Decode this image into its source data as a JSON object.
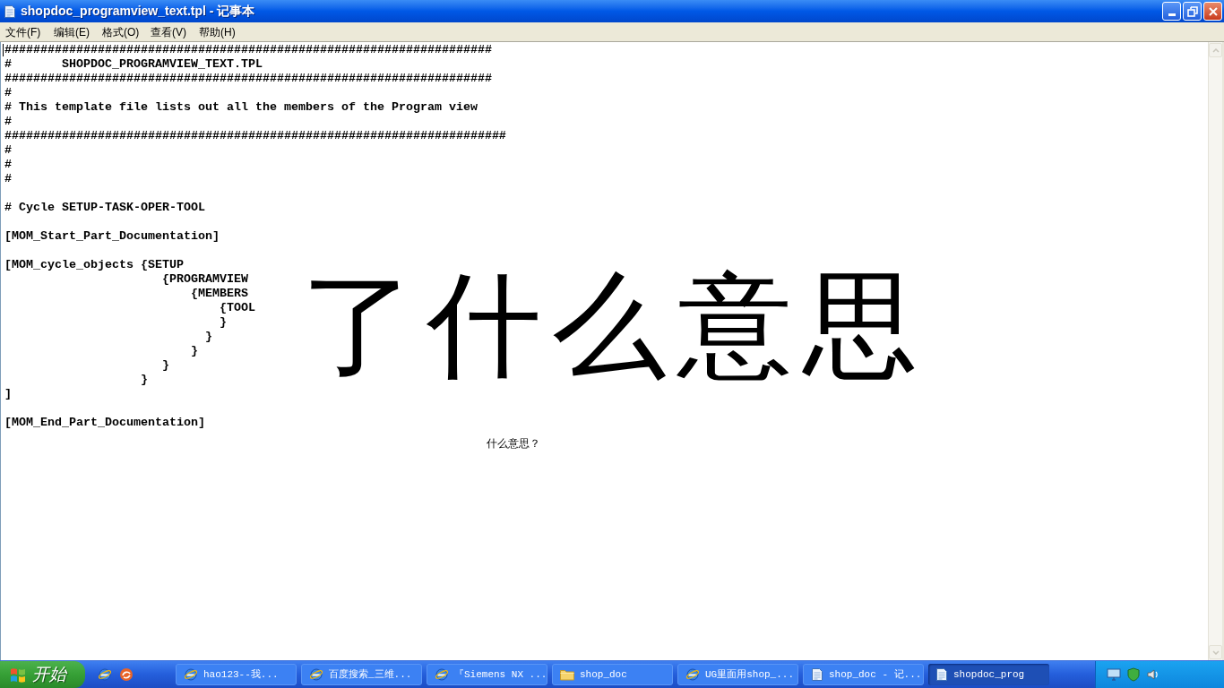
{
  "window": {
    "title": "shopdoc_programview_text.tpl - 记事本"
  },
  "menu": [
    "文件(F)",
    "编辑(E)",
    "格式(O)",
    "查看(V)",
    "帮助(H)"
  ],
  "editor": {
    "blocks": [
      [
        "####################################################################",
        "#       SHOPDOC_PROGRAMVIEW_TEXT.TPL",
        "####################################################################",
        "#",
        "# This template file lists out all the members of the Program view",
        "#",
        "######################################################################",
        "#",
        "#",
        "#"
      ],
      [
        "# Cycle SETUP-TASK-OPER-TOOL"
      ],
      [
        "[MOM_Start_Part_Documentation]"
      ],
      [
        "[MOM_cycle_objects {SETUP",
        "                      {PROGRAMVIEW",
        "                          {MEMBERS",
        "                              {TOOL",
        "                              }",
        "                            }",
        "                          }",
        "                      }",
        "                   }",
        "]"
      ],
      [
        "[MOM_End_Part_Documentation]"
      ]
    ]
  },
  "annotations": [
    {
      "kind": "handwriting",
      "text": "了什么意思"
    },
    {
      "kind": "note",
      "text": "什么意思？"
    }
  ],
  "taskbar": {
    "start": "开始",
    "tasks": [
      {
        "label": "hao123--我...",
        "kind": "browser",
        "selected": false
      },
      {
        "label": "百度搜索_三维...",
        "kind": "browser",
        "selected": false
      },
      {
        "label": "『Siemens NX ...",
        "kind": "browser",
        "selected": false
      },
      {
        "label": "shop_doc",
        "kind": "folder",
        "selected": false
      },
      {
        "label": "UG里面用shop_...",
        "kind": "browser",
        "selected": false
      },
      {
        "label": "shop_doc - 记...",
        "kind": "notepad",
        "selected": false
      },
      {
        "label": "shopdoc_prog",
        "kind": "notepad",
        "selected": true
      }
    ]
  }
}
